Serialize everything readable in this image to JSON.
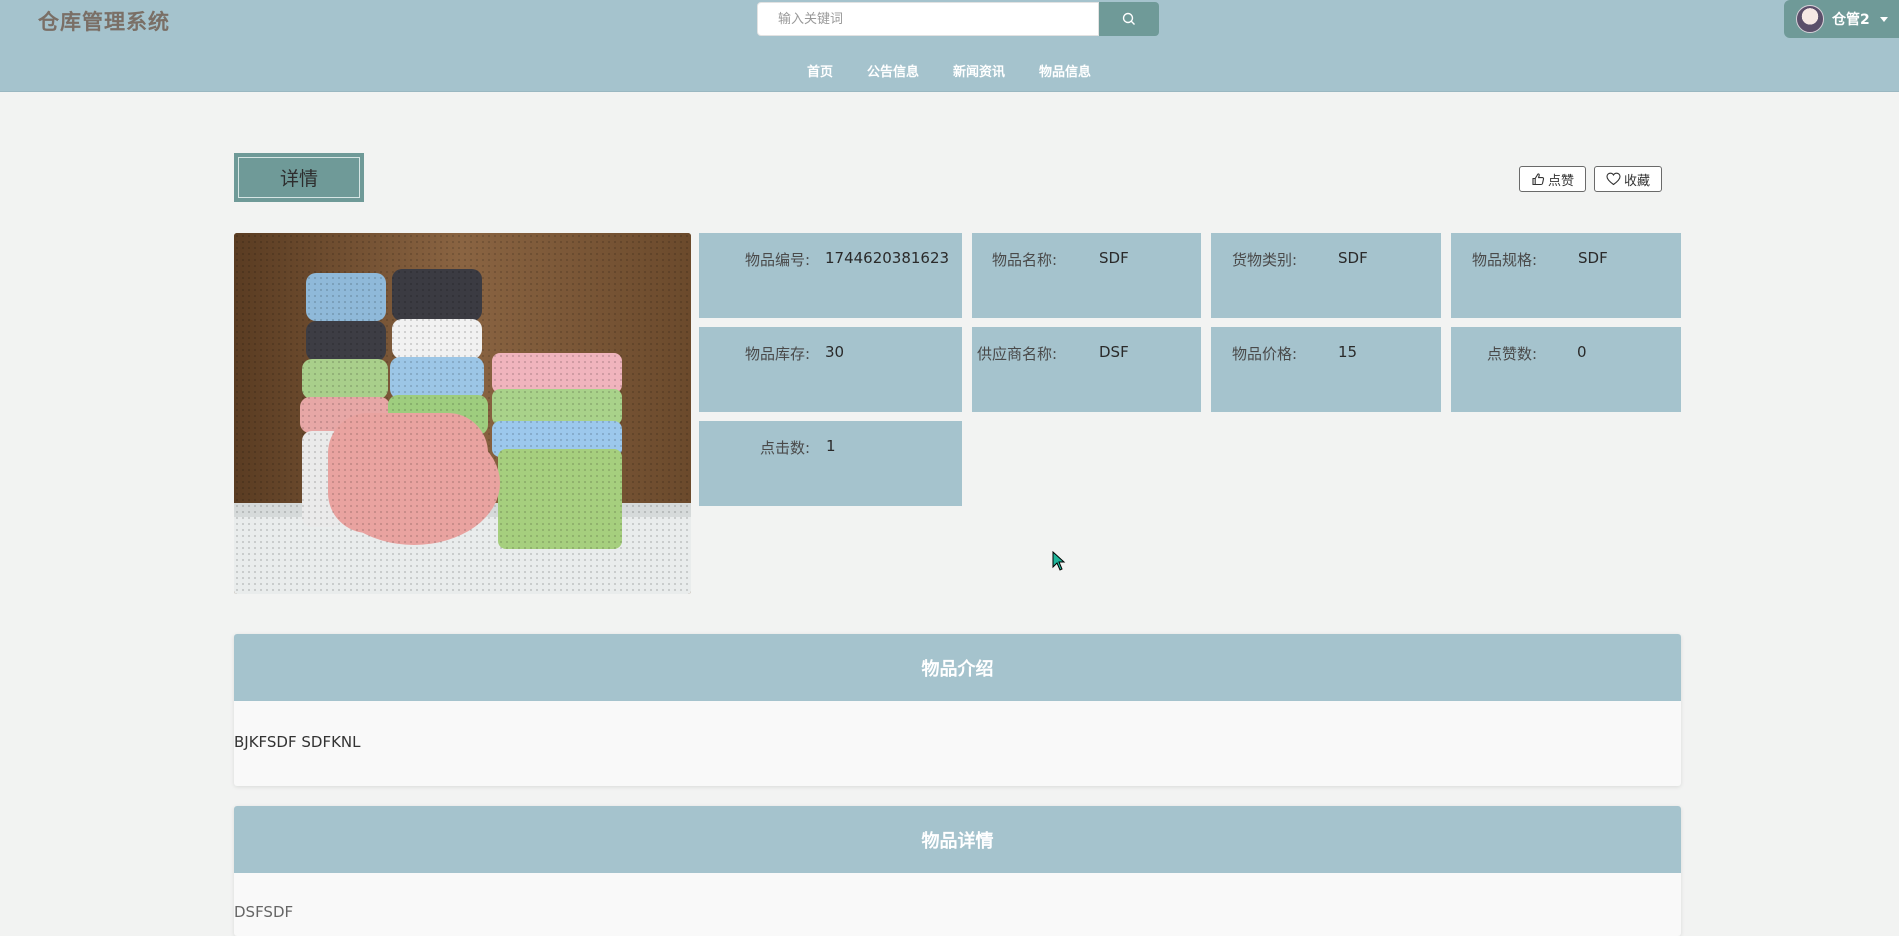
{
  "header": {
    "site_title": "仓库管理系统",
    "search_placeholder": "输入关键词",
    "nav": [
      "首页",
      "公告信息",
      "新闻资讯",
      "物品信息"
    ],
    "user_name": "仓管2"
  },
  "detail": {
    "title": "详情",
    "like_label": "点赞",
    "favorite_label": "收藏"
  },
  "info": [
    {
      "label": "物品编号:",
      "value": "1744620381623"
    },
    {
      "label": "物品名称:",
      "value": "SDF"
    },
    {
      "label": "货物类别:",
      "value": "SDF"
    },
    {
      "label": "物品规格:",
      "value": "SDF"
    },
    {
      "label": "物品库存:",
      "value": "30"
    },
    {
      "label": "供应商名称:",
      "value": "DSF"
    },
    {
      "label": "物品价格:",
      "value": "15"
    },
    {
      "label": "点赞数:",
      "value": "0"
    },
    {
      "label": "点击数:",
      "value": "1"
    }
  ],
  "sections": {
    "intro_title": "物品介绍",
    "intro_body": "BJKFSDF SDFKNL",
    "detail_title": "物品详情",
    "detail_body": "DSFSDF"
  },
  "colors": {
    "header_bg": "#a5c3cd",
    "accent": "#6f9a98",
    "page_bg": "#f2f3f2"
  }
}
